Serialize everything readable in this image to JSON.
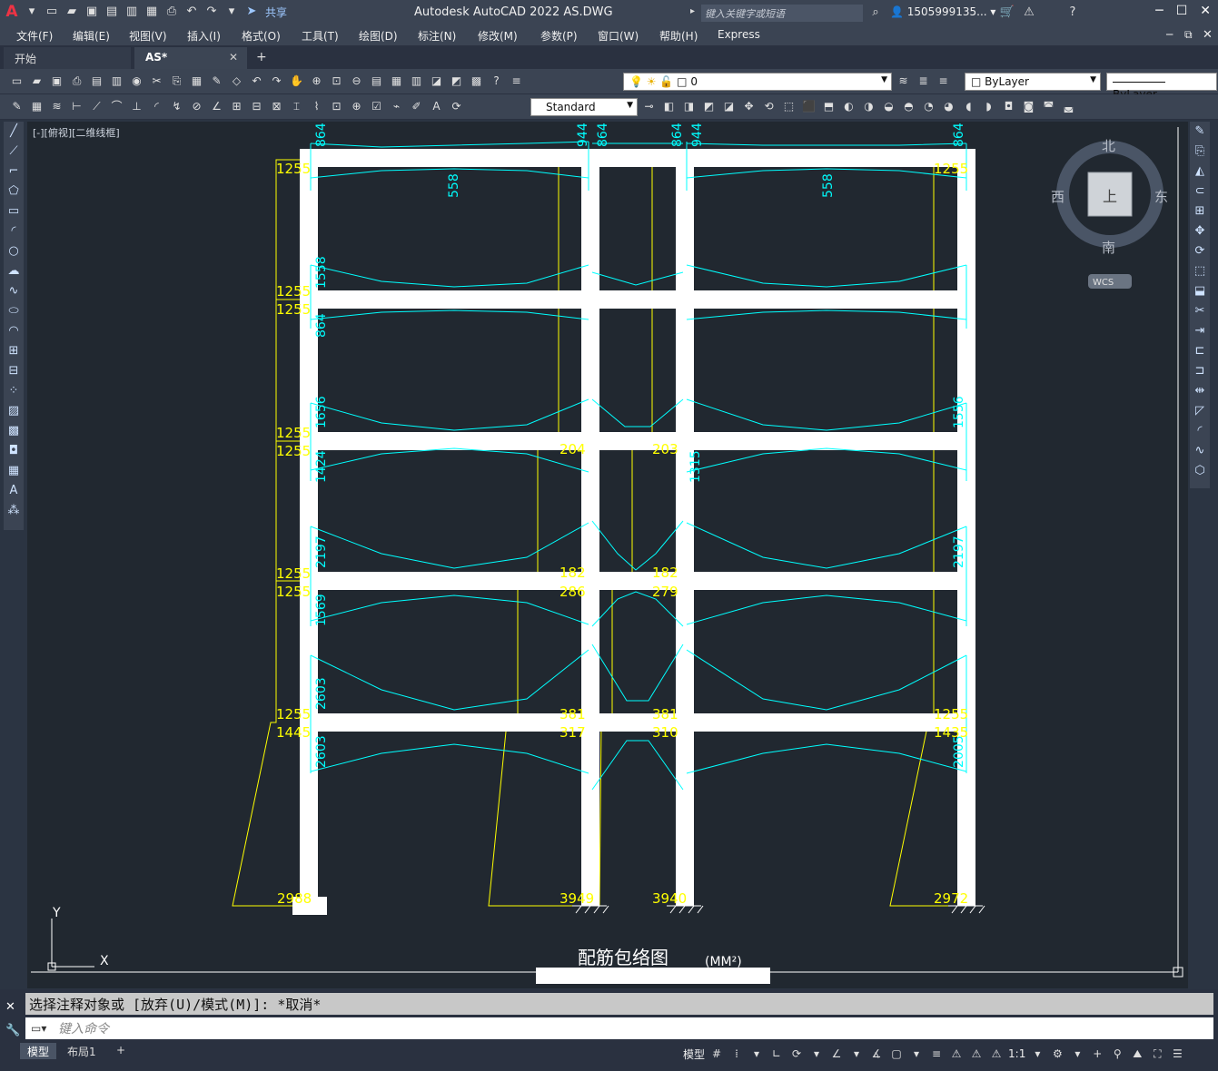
{
  "window": {
    "title": "Autodesk AutoCAD 2022    AS.DWG",
    "app_icon": "autocad-logo",
    "share_label": "共享",
    "search_placeholder": "键入关键字或短语",
    "user": "1505999135...",
    "min": "─",
    "max": "☐",
    "close": "✕"
  },
  "menu": [
    "文件(F)",
    "编辑(E)",
    "视图(V)",
    "插入(I)",
    "格式(O)",
    "工具(T)",
    "绘图(D)",
    "标注(N)",
    "修改(M)",
    "参数(P)",
    "窗口(W)",
    "帮助(H)",
    "Express"
  ],
  "tabs": {
    "start": "开始",
    "active": "AS*",
    "close": "✕",
    "add": "+"
  },
  "toolbar": {
    "layer_name": "0",
    "color": "ByLayer",
    "linetype": "ByLayer",
    "text_style": "Standard"
  },
  "viewport": {
    "label": "[-][俯视][二维线框]",
    "viewcube": {
      "north": "北",
      "south": "南",
      "east": "东",
      "west": "西",
      "top": "上",
      "wcs": "WCS"
    },
    "ucs": {
      "x": "X",
      "y": "Y"
    }
  },
  "drawing": {
    "title": "配筋包络图",
    "unit": "(MM²)",
    "colors": {
      "frame": "#ffffff",
      "column_envelope": "#ffff00",
      "beam_envelope": "#00ffff",
      "background": "#212830"
    },
    "col_top_labels": [
      "1255",
      "1255",
      "1255",
      "1255",
      "1255",
      "1255",
      "1255",
      "1255",
      "1255",
      "1255"
    ],
    "col_base_labels": [
      "2988",
      "3949",
      "3940",
      "2972"
    ],
    "col_first_labels": [
      "1445",
      "317",
      "310",
      "1435"
    ],
    "col_mid_labels": [
      "204",
      "203",
      "182",
      "182",
      "286",
      "279",
      "381",
      "381"
    ],
    "beam_top_labels": [
      "864",
      "944",
      "864",
      "864",
      "944",
      "864"
    ],
    "beam_mid_labels": [
      "558",
      "558"
    ],
    "beam_side_labels": [
      "1558",
      "864",
      "1656",
      "1424",
      "2197",
      "1569",
      "2603",
      "2603",
      "1315",
      "1556",
      "2197",
      "2005"
    ]
  },
  "command": {
    "history": "选择注释对象或 [放弃(U)/模式(M)]: *取消*",
    "placeholder": "键入命令"
  },
  "status": {
    "model_tab": "模型",
    "layout_tab": "布局1",
    "add": "+",
    "model_label": "模型",
    "scale": "1:1"
  }
}
